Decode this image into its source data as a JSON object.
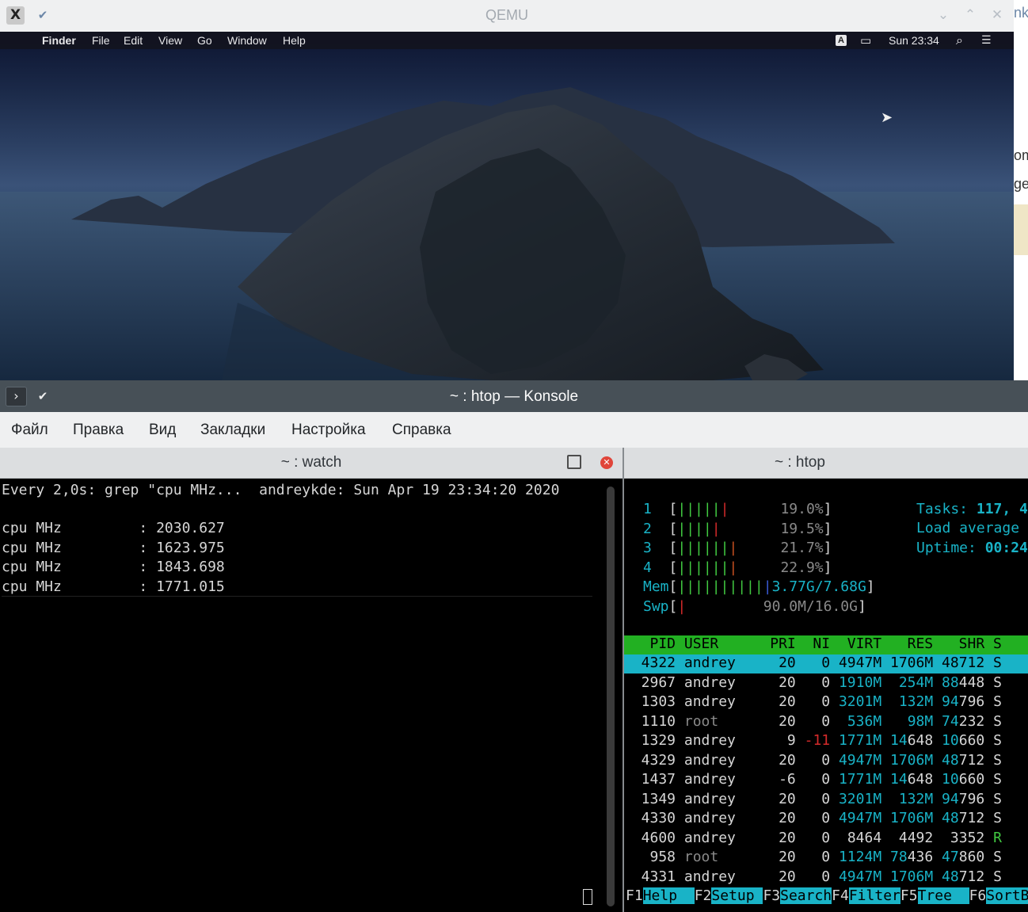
{
  "qemu": {
    "title": "QEMU",
    "app_icon": "X",
    "pin_icon": "✔",
    "minimize": "⌄",
    "maximize": "⌃",
    "close": "✕"
  },
  "mac": {
    "menu": [
      "Finder",
      "File",
      "Edit",
      "View",
      "Go",
      "Window",
      "Help"
    ],
    "input_source": "A",
    "clock": "Sun 23:34",
    "apple_glyph": "",
    "display_glyph": "▭",
    "search_glyph": "⌕",
    "list_glyph": "☰"
  },
  "bg_window": {
    "fragments": [
      "nk",
      "om",
      "ge?"
    ]
  },
  "konsole": {
    "title": "~ : htop — Konsole",
    "app_icon": "›",
    "menu": [
      "Файл",
      "Правка",
      "Вид",
      "Закладки",
      "Настройка",
      "Справка"
    ],
    "watch_tab": "~ : watch",
    "htop_tab": "~ : htop"
  },
  "watch": {
    "header": "Every 2,0s: grep \"cpu MHz...  andreykde: Sun Apr 19 23:34:20 2020",
    "lines": [
      "cpu MHz         : 2030.627",
      "cpu MHz         : 1623.975",
      "cpu MHz         : 1843.698",
      "cpu MHz         : 1771.015"
    ]
  },
  "htop": {
    "cpus": [
      {
        "id": "1",
        "bars": 6,
        "bar_colors": "gggggr",
        "pct": "19.0%"
      },
      {
        "id": "2",
        "bars": 5,
        "bar_colors": "ggggr",
        "pct": "19.5%"
      },
      {
        "id": "3",
        "bars": 7,
        "bar_colors": "ggggggo",
        "pct": "21.7%"
      },
      {
        "id": "4",
        "bars": 7,
        "bar_colors": "ggggggo",
        "pct": "22.9%"
      }
    ],
    "mem_label": "Mem",
    "mem_value": "3.77G/7.68G",
    "swp_label": "Swp",
    "swp_value": "90.0M/16.0G",
    "tasks_label": "Tasks:",
    "tasks_value": "117, 4",
    "load_label": "Load average",
    "uptime_label": "Uptime:",
    "uptime_value": "00:24",
    "columns": [
      "PID",
      "USER",
      "PRI",
      "NI",
      "VIRT",
      "RES",
      "SHR",
      "S"
    ],
    "processes": [
      {
        "pid": "4322",
        "user": "andrey",
        "pri": "20",
        "ni": "0",
        "virt": "4947M",
        "res": "1706M",
        "shr": "48712",
        "s": "S"
      },
      {
        "pid": "2967",
        "user": "andrey",
        "pri": "20",
        "ni": "0",
        "virt": "1910M",
        "res": "254M",
        "shr": "88448",
        "s": "S"
      },
      {
        "pid": "1303",
        "user": "andrey",
        "pri": "20",
        "ni": "0",
        "virt": "3201M",
        "res": "132M",
        "shr": "94796",
        "s": "S"
      },
      {
        "pid": "1110",
        "user": "root",
        "pri": "20",
        "ni": "0",
        "virt": "536M",
        "res": "98M",
        "shr": "74232",
        "s": "S"
      },
      {
        "pid": "1329",
        "user": "andrey",
        "pri": "9",
        "ni": "-11",
        "virt": "1771M",
        "res": "14648",
        "shr": "10660",
        "s": "S"
      },
      {
        "pid": "4329",
        "user": "andrey",
        "pri": "20",
        "ni": "0",
        "virt": "4947M",
        "res": "1706M",
        "shr": "48712",
        "s": "S"
      },
      {
        "pid": "1437",
        "user": "andrey",
        "pri": "-6",
        "ni": "0",
        "virt": "1771M",
        "res": "14648",
        "shr": "10660",
        "s": "S"
      },
      {
        "pid": "1349",
        "user": "andrey",
        "pri": "20",
        "ni": "0",
        "virt": "3201M",
        "res": "132M",
        "shr": "94796",
        "s": "S"
      },
      {
        "pid": "4330",
        "user": "andrey",
        "pri": "20",
        "ni": "0",
        "virt": "4947M",
        "res": "1706M",
        "shr": "48712",
        "s": "S"
      },
      {
        "pid": "4600",
        "user": "andrey",
        "pri": "20",
        "ni": "0",
        "virt": "8464",
        "res": "4492",
        "shr": "3352",
        "s": "R"
      },
      {
        "pid": "958",
        "user": "root",
        "pri": "20",
        "ni": "0",
        "virt": "1124M",
        "res": "78436",
        "shr": "47860",
        "s": "S"
      },
      {
        "pid": "4331",
        "user": "andrey",
        "pri": "20",
        "ni": "0",
        "virt": "4947M",
        "res": "1706M",
        "shr": "48712",
        "s": "S"
      }
    ],
    "fkeys": [
      {
        "key": "F1",
        "label": "Help  "
      },
      {
        "key": "F2",
        "label": "Setup "
      },
      {
        "key": "F3",
        "label": "Search"
      },
      {
        "key": "F4",
        "label": "Filter"
      },
      {
        "key": "F5",
        "label": "Tree  "
      },
      {
        "key": "F6",
        "label": "SortBy"
      }
    ]
  },
  "colors": {
    "htop_green": "#2aae22",
    "htop_cyan": "#19b3c7",
    "header_bg": "#22b022",
    "selected_bg": "#19b3c7"
  }
}
